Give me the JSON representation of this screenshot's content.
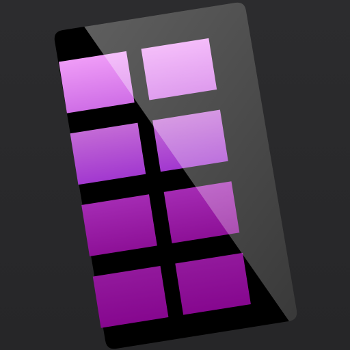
{
  "icon": {
    "name": "app-grid-icon",
    "background_color": "#2a2a2c",
    "panel_color": "#000000",
    "glare_color": "#ffffff",
    "tile_colors": {
      "top": "#e58ff0",
      "upper_mid": "#b450d6",
      "lower_mid": "#9a1fa8",
      "bottom": "#890f93"
    },
    "grid": {
      "rows": 4,
      "columns": 2
    }
  }
}
